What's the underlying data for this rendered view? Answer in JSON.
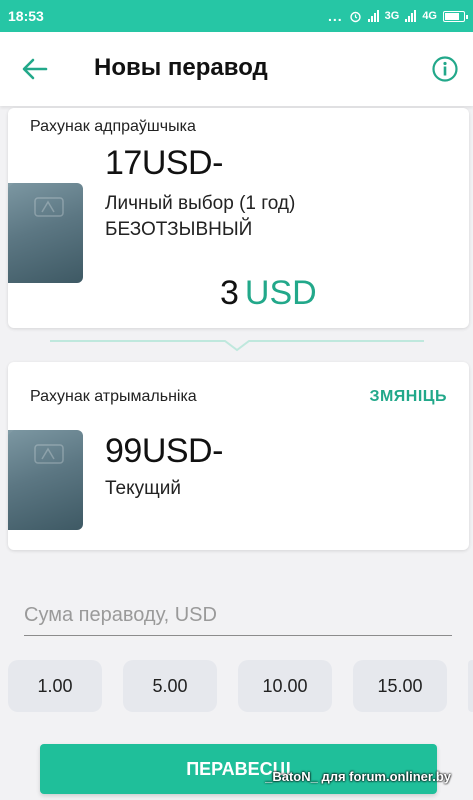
{
  "status_bar": {
    "time": "18:53",
    "dots": "...",
    "network_3g": "3G",
    "network_4g": "4G"
  },
  "header": {
    "title": "Новы перавод",
    "back_icon": "arrow-left-icon",
    "info_icon": "info-circle-icon"
  },
  "sender": {
    "label": "Рахунак адпраўшчыка",
    "account": "17USD-",
    "description_line1": "Личный выбор (1 год)",
    "description_line2": "БЕЗОТЗЫВНЫЙ",
    "balance": "3",
    "currency": "USD"
  },
  "recipient": {
    "label": "Рахунак атрымальніка",
    "change_label": "ЗМЯНІЦЬ",
    "account": "99USD-",
    "description": "Текущий"
  },
  "amount_input": {
    "placeholder": "Сума пераводу, USD",
    "value": ""
  },
  "quick_amounts": [
    "1.00",
    "5.00",
    "10.00",
    "15.00"
  ],
  "submit_label": "ПЕРАВЕСЦІ",
  "watermark": "_BatoN_ для forum.onliner.by",
  "colors": {
    "accent": "#26c6a5",
    "accent_text": "#22a88a",
    "button": "#1fbf9a"
  }
}
